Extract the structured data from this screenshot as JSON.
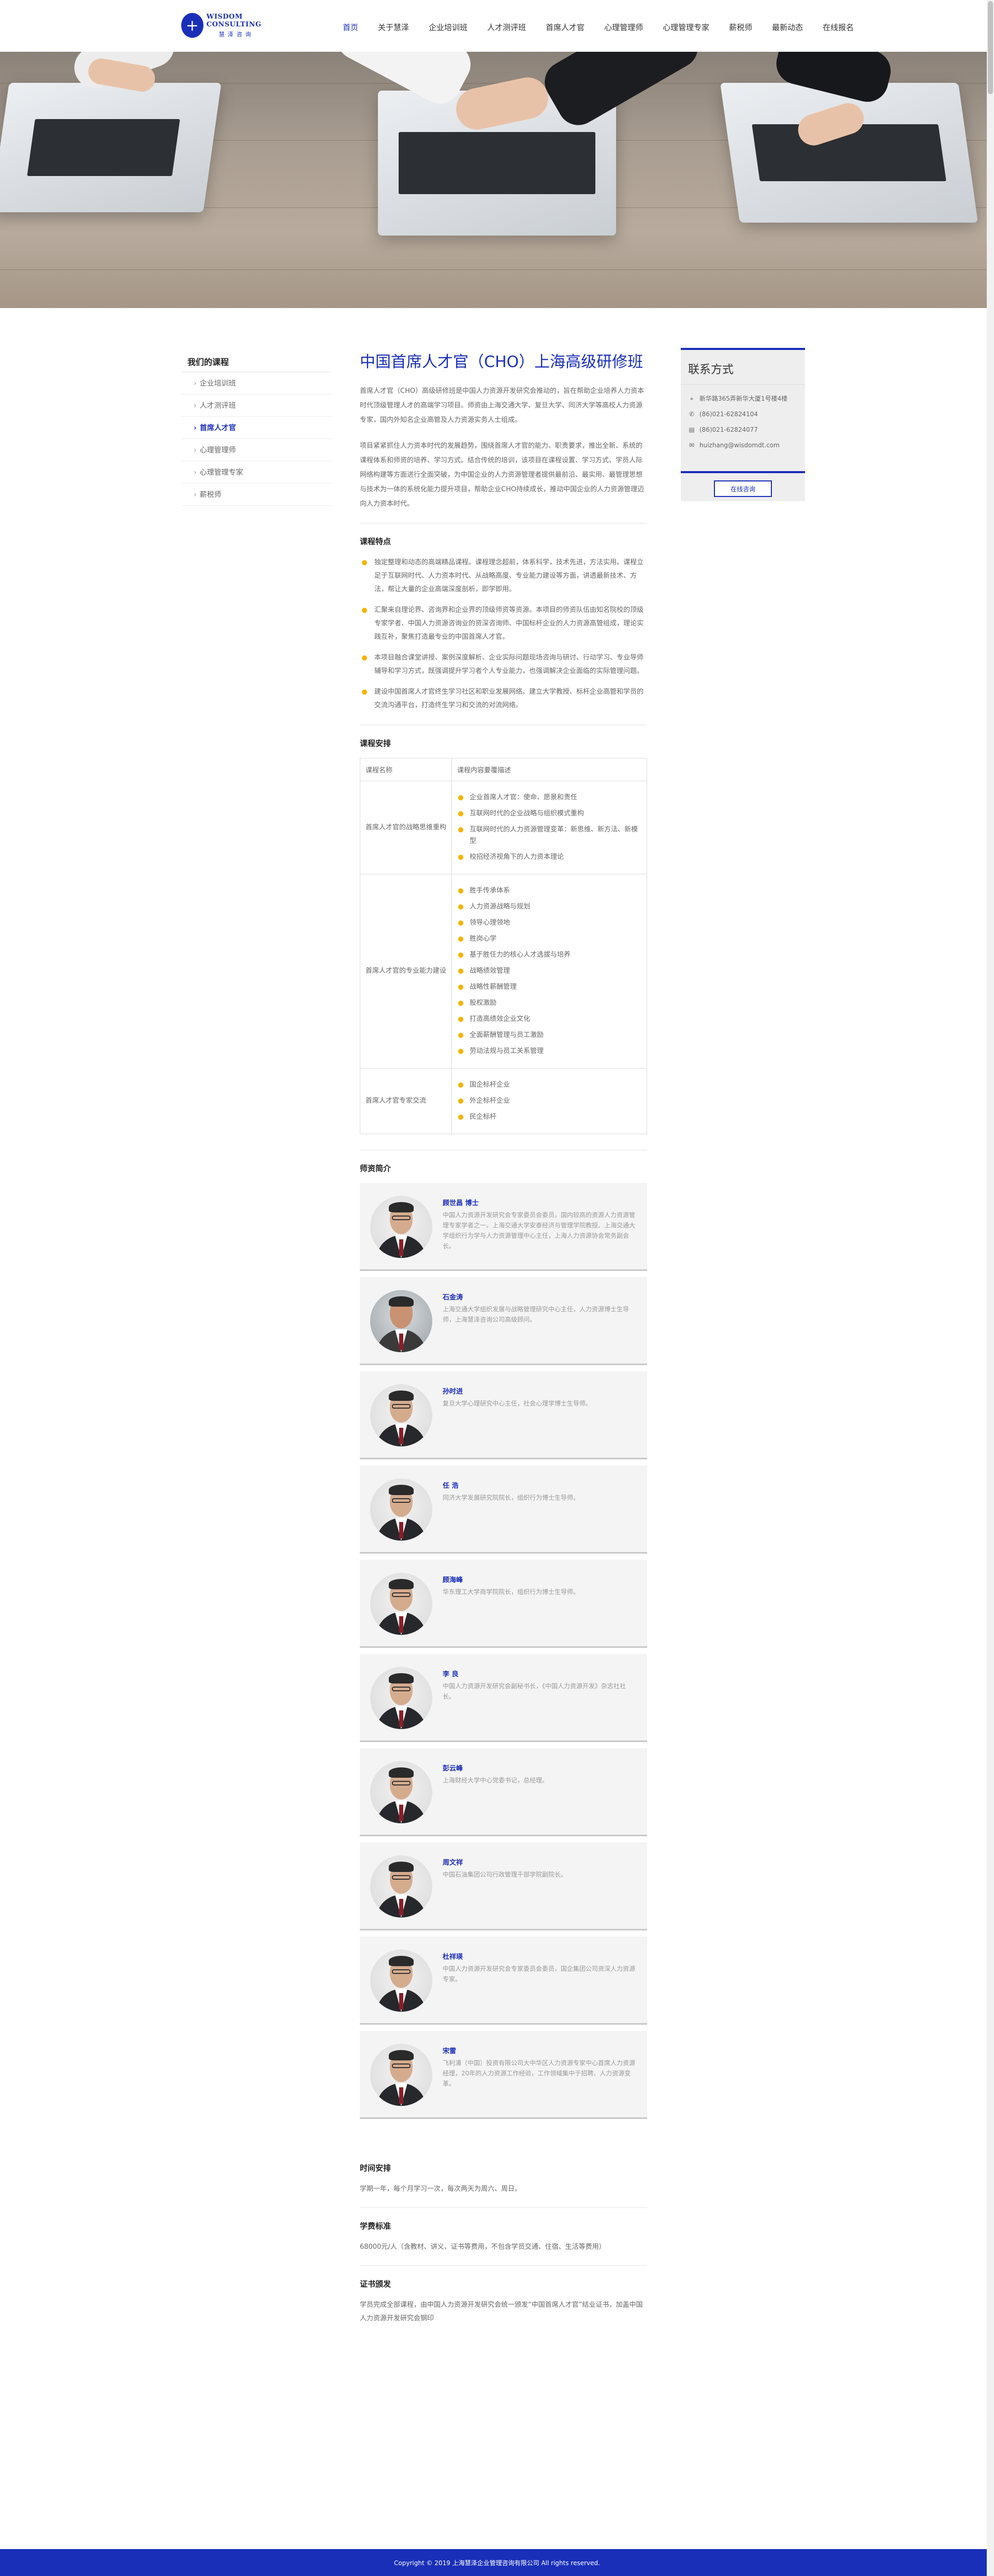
{
  "header": {
    "logo_symbol": "+",
    "logo_en": "WISDOM CONSULTING",
    "logo_cn": "慧泽咨询",
    "nav": [
      "首页",
      "关于慧泽",
      "企业培训班",
      "人才测评班",
      "首席人才官",
      "心理管理师",
      "心理管理专家",
      "薪税师",
      "最新动态",
      "在线报名"
    ]
  },
  "sidebar": {
    "title": "我们的课程",
    "items": [
      "企业培训班",
      "人才测评班",
      "首席人才官",
      "心理管理师",
      "心理管理专家",
      "薪税师"
    ]
  },
  "main": {
    "title": "中国首席人才官（CHO）上海高级研修班",
    "intro1": "首席人才官（CHO）高级研修班是中国人力资源开发研究会推动的，旨在帮助企业培养人力资本时代顶级管理人才的高端学习项目。师资由上海交通大学、复旦大学、同济大学等高校人力资源专家，国内外知名企业高管及人力资源实务人士组成。",
    "intro2": "项目紧紧抓住人力资本时代的发展趋势，围绕首席人才官的能力、职责要求，推出全新、系统的课程体系和师资的培养、学习方式。结合传统的培训，该项目在课程设置、学习方式、学员人际网络构建等方面进行全面突破，为中国企业的人力资源管理者提供最前沿、最实用、最管理思想与技术为一体的系统化能力提升项目，帮助企业CHO持续成长，推动中国企业的人力资源管理迈向人力资本时代。",
    "features_title": "课程特点",
    "features": [
      "独定整理和动态的高端精品课程。课程理念超前，体系科学，技术先进，方法实用。课程立足于互联网时代、人力资本时代、从战略高度、专业能力建设等方面，讲透最新技术、方法，帮让大量的企业高端深度剖析，即学即用。",
      "汇聚来自理论界、咨询界和企业界的顶级师资等资源。本项目的师资队伍由知名院校的顶级专家学者、中国人力资源咨询业的资深咨询师、中国标杆企业的人力资源高管组成，理论实践互补，聚焦打造最专业的中国首席人才官。",
      "本项目融合课堂讲授、案例深度解析、企业实际问题现场咨询与研讨、行动学习、专业导师辅导和学习方式，既强调提升学习者个人专业能力，也强调解决企业面临的实际管理问题。",
      "建设中国首席人才官终生学习社区和职业发展网络。建立大学教授、标杆企业高管和学员的交流沟通平台，打造终生学习和交流的对流网络。"
    ],
    "schedule_title": "课程安排",
    "schedule_headers": [
      "课程名称",
      "课程内容要覆描述"
    ],
    "schedule": [
      {
        "module": "首席人才官的战略思维重构",
        "items": [
          "企业首席人才官：使命、愿景和责任",
          "互联网时代的企业战略与组织模式重构",
          "互联网时代的人力资源管理变革：新思维、新方法、新模型",
          "校招经济视角下的人力资本理论"
        ]
      },
      {
        "module": "首席人才官的专业能力建设",
        "items": [
          "胜手传承体系",
          "人力资源战略与规划",
          "领导心理领地",
          "胜岗心学",
          "基于胜任力的核心人才选拔与培养",
          "战略绩效管理",
          "战略性薪酬管理",
          "股权激励",
          "打造高绩效企业文化",
          "全面薪酬管理与员工激励",
          "劳动法规与员工关系管理"
        ]
      },
      {
        "module": "首席人才官专家交流",
        "items": [
          "国企标杆企业",
          "外企标杆企业",
          "民企标杆"
        ]
      }
    ],
    "teachers_title": "师资简介",
    "teachers": [
      {
        "name": "顾世昌 博士",
        "desc": "中国人力资源开发研究会专家委员会委员，国内较高的资源人力资源管理专家学者之一。上海交通大学安泰经济与管理学院教授、上海交通大学组织行为学与人力资源管理中心主任，上海人力资源协会常务副会长。"
      },
      {
        "name": "石金涛",
        "desc": "上海交通大学组织发展与战略管理研究中心主任，人力资源博士生导师，上海慧泽咨询公司高级顾问。"
      },
      {
        "name": "孙时进",
        "desc": "复旦大学心理研究中心主任，社会心理学博士生导师。"
      },
      {
        "name": "任 浩",
        "desc": "同济大学发展研究院院长，组织行为博士生导师。"
      },
      {
        "name": "顾海峰",
        "desc": "华东理工大学商学院院长，组织行为博士生导师。"
      },
      {
        "name": "李 良",
        "desc": "中国人力资源开发研究会副秘书长，《中国人力资源开发》杂志社社长。"
      },
      {
        "name": "彭云峰",
        "desc": "上海财经大学中心党委书记，总经理。"
      },
      {
        "name": "周文祥",
        "desc": "中国石油集团公司行政管理干部学院副院长。"
      },
      {
        "name": "杜祥瑛",
        "desc": "中国人力资源开发研究会专家委员会委员，国企集团公司资深人力资源专家。"
      },
      {
        "name": "宋雷",
        "desc": "飞利浦（中国）投资有限公司大中华区人力资源专家中心首席人力资源经理，20年的人力资源工作经验，工作领域集中于招聘、人力资源变革。"
      }
    ],
    "time_title": "时间安排",
    "time_text": "学期一年，每个月学习一次，每次两天为周六、周日。",
    "fee_title": "学费标准",
    "fee_text": "68000元/人（含教材、讲义、证书等费用，不包含学员交通、住宿、生活等费用）",
    "cert_title": "证书颁发",
    "cert_text": "学员完成全部课程，由中国人力资源开发研究会统一颁发“中国首席人才官”结业证书，加盖中国人力资源开发研究会钢印"
  },
  "contact": {
    "title": "联系方式",
    "address": "新华路365弄新华大厦1号楼4楼",
    "phone1": "(86)021-62824104",
    "phone2": "(86)021-62824077",
    "email": "huizhang@wisdomdt.com",
    "button": "在线咨询"
  },
  "footer": {
    "copyright": "Copyright © 2019 上海慧泽企业管理咨询有限公司 All rights reserved."
  },
  "colors": {
    "brand": "#1a2fb8",
    "bullet": "#f4b400"
  }
}
